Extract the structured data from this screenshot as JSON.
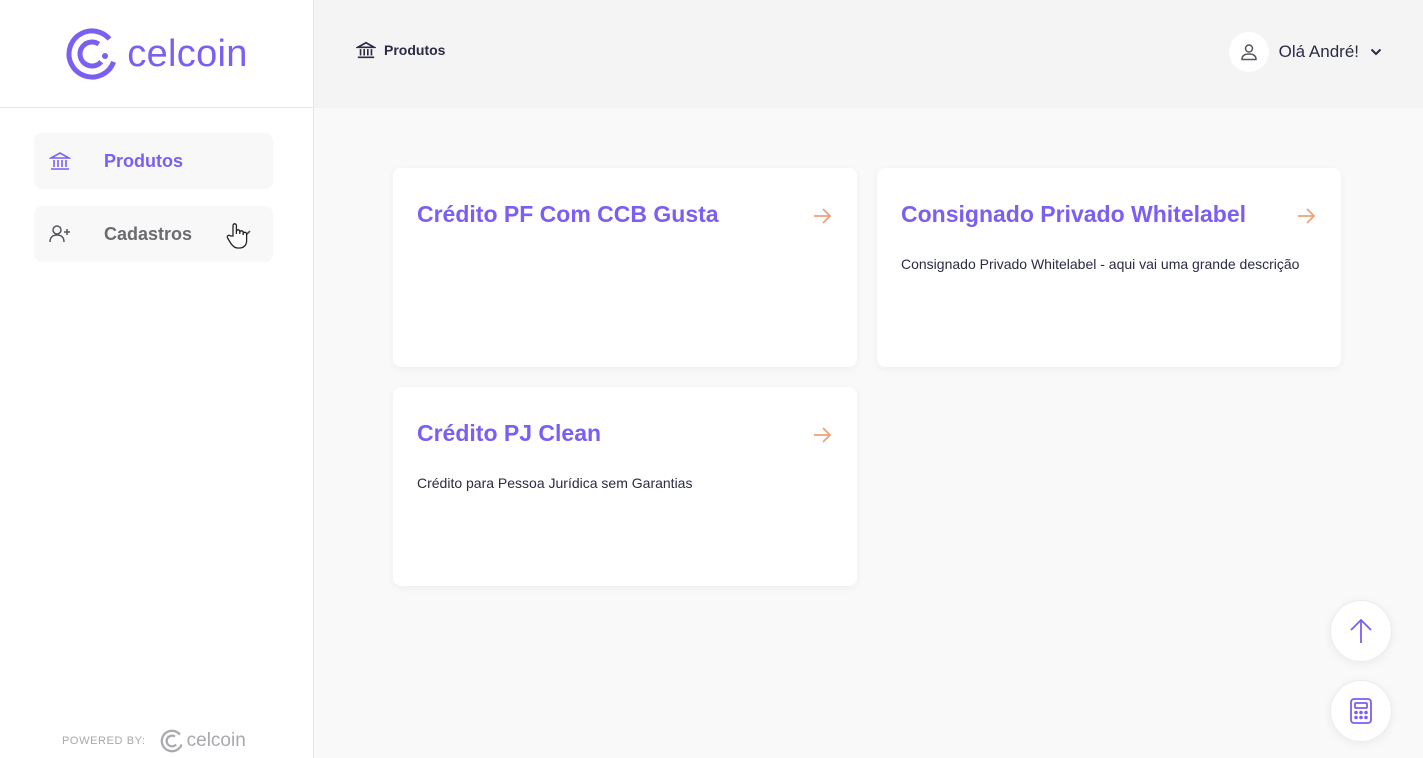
{
  "brand": {
    "name": "celcoin",
    "color": "#7b5ef2"
  },
  "sidebar": {
    "items": [
      {
        "label": "Produtos",
        "icon": "bank-icon",
        "active": true
      },
      {
        "label": "Cadastros",
        "icon": "user-plus-icon",
        "active": false
      }
    ],
    "footer": {
      "powered_label": "POWERED BY:",
      "brand": "celcoin"
    }
  },
  "header": {
    "breadcrumb": {
      "label": "Produtos",
      "icon": "bank-icon"
    },
    "user": {
      "greeting": "Olá André!",
      "icon": "user-icon"
    }
  },
  "products": [
    {
      "title": "Crédito PF Com CCB Gusta",
      "description": ""
    },
    {
      "title": "Consignado Privado Whitelabel",
      "description": "Consignado Privado Whitelabel - aqui vai uma grande descrição"
    },
    {
      "title": "Crédito PJ Clean",
      "description": "Crédito para Pessoa Jurídica sem Garantias"
    }
  ],
  "colors": {
    "accent": "#7b5ef2",
    "arrow": "#f0a07a",
    "text": "#2b2b45"
  },
  "floating_buttons": [
    {
      "icon": "arrow-up-icon"
    },
    {
      "icon": "calculator-icon"
    }
  ]
}
